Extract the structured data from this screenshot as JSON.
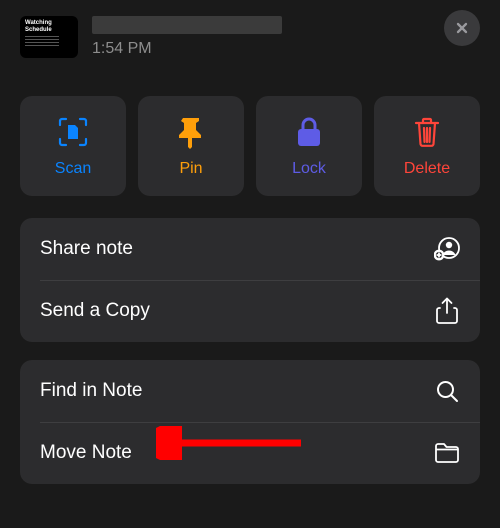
{
  "header": {
    "thumbnail_title": "Watching Schedule",
    "time": "1:54 PM"
  },
  "tiles": {
    "scan": "Scan",
    "pin": "Pin",
    "lock": "Lock",
    "delete": "Delete"
  },
  "menu1": {
    "share": "Share note",
    "send": "Send a Copy"
  },
  "menu2": {
    "find": "Find in Note",
    "move": "Move Note"
  }
}
